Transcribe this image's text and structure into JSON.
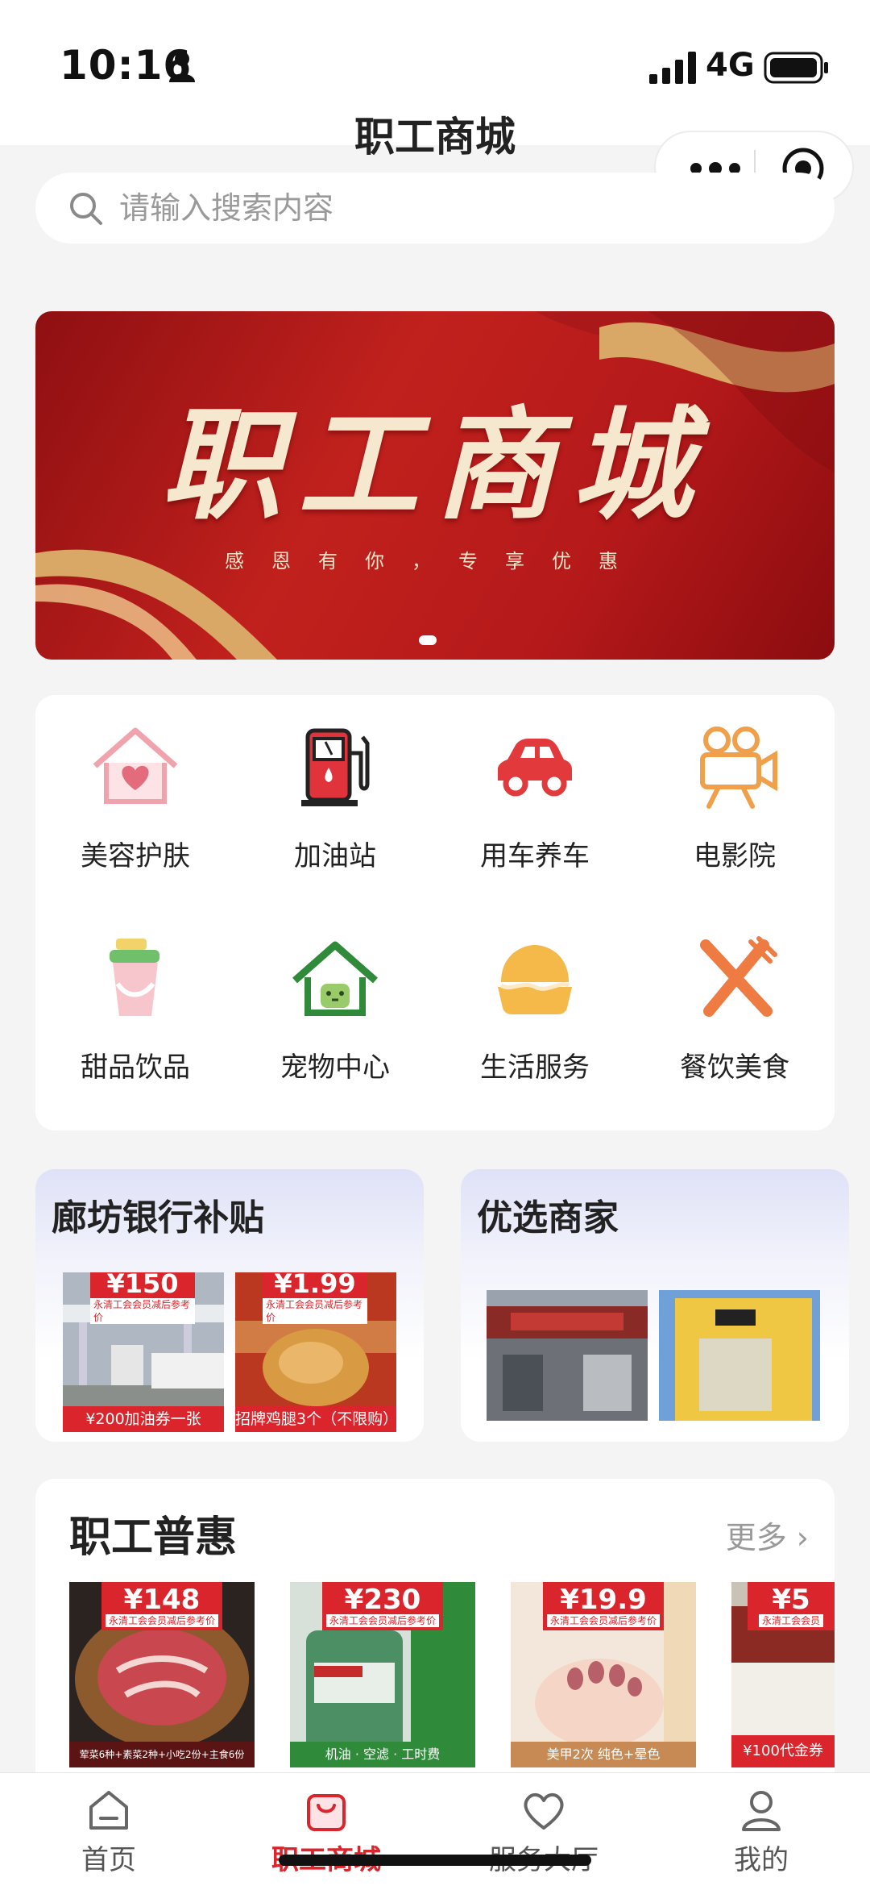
{
  "status_bar": {
    "time": "10:16",
    "network": "4G"
  },
  "header": {
    "title": "职工商城"
  },
  "search": {
    "placeholder": "请输入搜索内容"
  },
  "banner": {
    "title": "职工商城",
    "subtitle": "感恩有你，专享优惠"
  },
  "categories": [
    {
      "label": "美容护肤",
      "icon": "house-heart-icon"
    },
    {
      "label": "加油站",
      "icon": "fuel-pump-icon"
    },
    {
      "label": "用车养车",
      "icon": "car-icon"
    },
    {
      "label": "电影院",
      "icon": "movie-camera-icon"
    },
    {
      "label": "甜品饮品",
      "icon": "drink-cup-icon"
    },
    {
      "label": "宠物中心",
      "icon": "pet-house-icon"
    },
    {
      "label": "生活服务",
      "icon": "bun-icon"
    },
    {
      "label": "餐饮美食",
      "icon": "fork-knife-icon"
    }
  ],
  "promos": {
    "bank": {
      "title": "廊坊银行补贴",
      "items": [
        {
          "price": "¥150",
          "note": "永清工会会员减后参考价",
          "caption": "¥200加油券一张"
        },
        {
          "price": "¥1.99",
          "note": "永清工会会员减后参考价",
          "caption": "招牌鸡腿3个（不限购）"
        }
      ]
    },
    "merchants": {
      "title": "优选商家"
    }
  },
  "deals": {
    "title": "职工普惠",
    "more_label": "更多 ›",
    "items": [
      {
        "price": "¥148",
        "note": "永清工会会员减后参考价",
        "caption": "荤菜6种+素菜2种+小吃2份+主食6份"
      },
      {
        "price": "¥230",
        "note": "永清工会会员减后参考价",
        "caption": "机油 · 空滤 · 工时费"
      },
      {
        "price": "¥19.9",
        "note": "永清工会会员减后参考价",
        "caption": "美甲2次 纯色+晕色"
      },
      {
        "price": "¥5",
        "note": "永清工会会员",
        "caption": "¥100代金券"
      }
    ]
  },
  "tabs": [
    {
      "label": "首页",
      "active": false
    },
    {
      "label": "职工商城",
      "active": true
    },
    {
      "label": "服务大厅",
      "active": false
    },
    {
      "label": "我的",
      "active": false
    }
  ],
  "colors": {
    "accent": "#d9252b",
    "banner_red": "#b5191a",
    "gold": "#f6e7cf"
  }
}
